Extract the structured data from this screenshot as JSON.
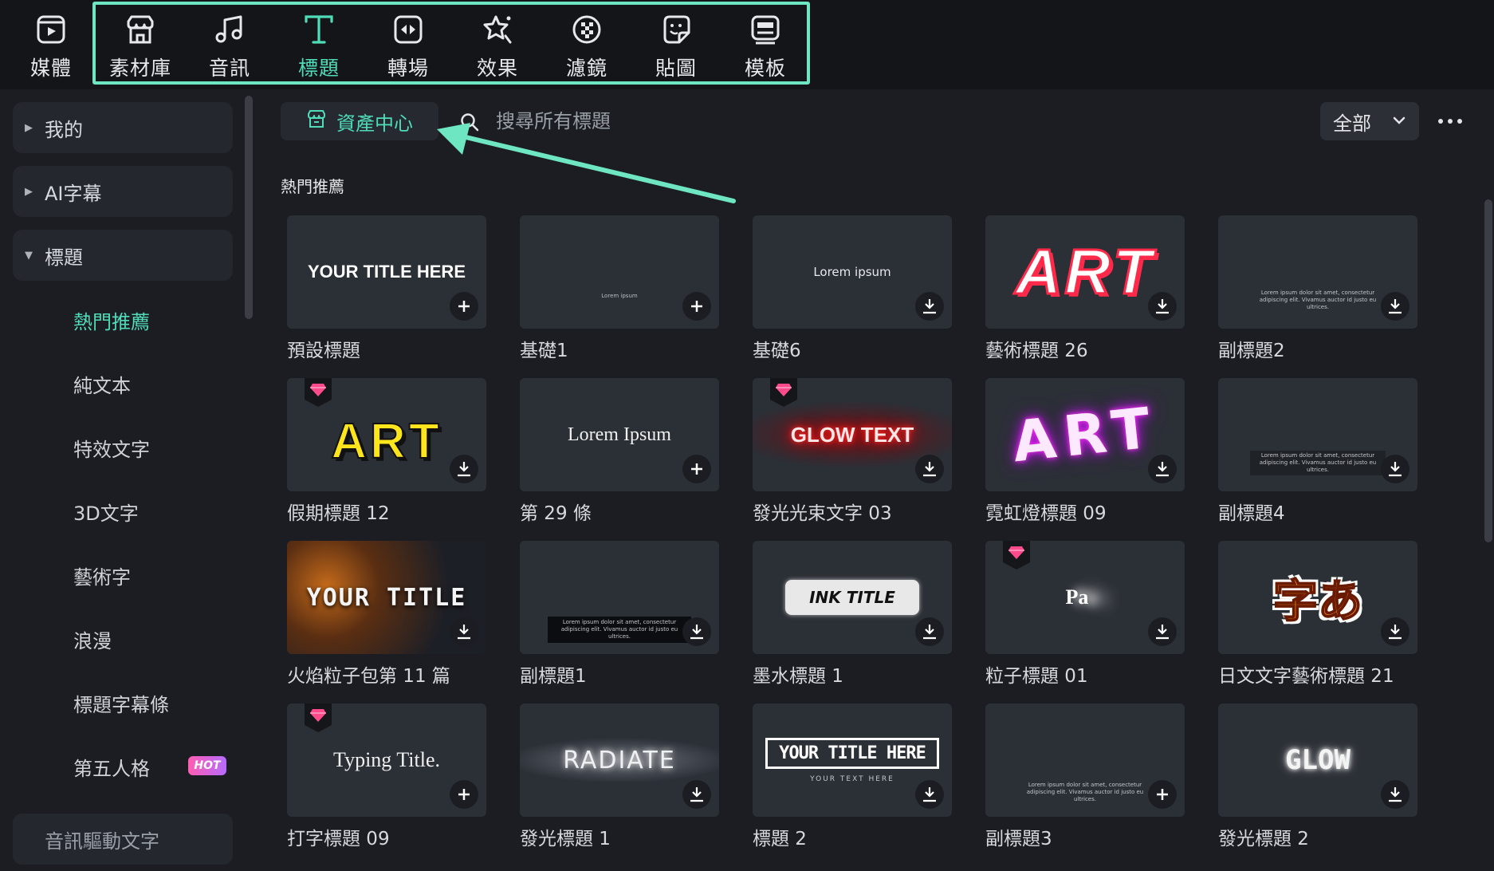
{
  "toolbar": {
    "items": [
      {
        "label": "媒體",
        "icon": "media-icon"
      },
      {
        "label": "素材庫",
        "icon": "stock-library-icon"
      },
      {
        "label": "音訊",
        "icon": "music-note-icon"
      },
      {
        "label": "標題",
        "icon": "title-t-icon"
      },
      {
        "label": "轉場",
        "icon": "transition-icon"
      },
      {
        "label": "效果",
        "icon": "effects-star-icon"
      },
      {
        "label": "濾鏡",
        "icon": "filter-icon"
      },
      {
        "label": "貼圖",
        "icon": "sticker-icon"
      },
      {
        "label": "模板",
        "icon": "template-icon"
      }
    ],
    "active": "標題"
  },
  "sidebar": {
    "groups": [
      {
        "label": "我的",
        "expanded": false
      },
      {
        "label": "AI字幕",
        "expanded": false
      },
      {
        "label": "標題",
        "expanded": true
      },
      {
        "label": "音訊驅動文字",
        "expanded": false
      }
    ],
    "subitems": [
      "熱門推薦",
      "純文本",
      "特效文字",
      "3D文字",
      "藝術字",
      "浪漫",
      "標題字幕條",
      "第五人格"
    ],
    "active_sub": "熱門推薦",
    "hot_badge": "HOT"
  },
  "main": {
    "asset_center_label": "資產中心",
    "search_placeholder": "搜尋所有標題",
    "filter_value": "全部",
    "section_title": "熱門推薦"
  },
  "cards": [
    {
      "name": "預設標題",
      "thumb_text": "YOUR TITLE HERE",
      "action": "add",
      "premium": false
    },
    {
      "name": "基礎1",
      "thumb_text": "Lorem ipsum",
      "action": "add",
      "premium": false
    },
    {
      "name": "基礎6",
      "thumb_text": "Lorem ipsum",
      "action": "download",
      "premium": false
    },
    {
      "name": "藝術標題 26",
      "thumb_text": "ART",
      "action": "download",
      "premium": false
    },
    {
      "name": "副標題2",
      "thumb_text": "Lorem ipsum dolor sit amet, consectetur adipiscing elit. Vivamus auctor id justo eu ultrices.",
      "action": "download",
      "premium": false
    },
    {
      "name": "假期標題 12",
      "thumb_text": "ART",
      "action": "download",
      "premium": true
    },
    {
      "name": "第 29 條",
      "thumb_text": "Lorem Ipsum",
      "action": "add",
      "premium": false
    },
    {
      "name": "發光光束文字 03",
      "thumb_text": "GLOW TEXT",
      "action": "download",
      "premium": true
    },
    {
      "name": "霓虹燈標題 09",
      "thumb_text": "ART",
      "action": "download",
      "premium": false
    },
    {
      "name": "副標題4",
      "thumb_text": "Lorem ipsum dolor sit amet, consectetur adipiscing elit. Vivamus auctor id justo eu ultrices.",
      "action": "download",
      "premium": false
    },
    {
      "name": "火焰粒子包第 11 篇",
      "thumb_text": "YOUR TITLE",
      "action": "download",
      "premium": false
    },
    {
      "name": "副標題1",
      "thumb_text": "Lorem ipsum dolor sit amet, consectetur adipiscing elit. Vivamus auctor id justo eu ultrices.",
      "action": "download",
      "premium": false
    },
    {
      "name": "墨水標題 1",
      "thumb_text": "INK TITLE",
      "action": "download",
      "premium": false
    },
    {
      "name": "粒子標題 01",
      "thumb_text": "Pa",
      "action": "download",
      "premium": true
    },
    {
      "name": "日文文字藝術標題 21",
      "thumb_text": "字あ",
      "action": "download",
      "premium": false
    },
    {
      "name": "打字標題 09",
      "thumb_text": "Typing Title.",
      "action": "add",
      "premium": true
    },
    {
      "name": "發光標題 1",
      "thumb_text": "RADIATE",
      "action": "download",
      "premium": false
    },
    {
      "name": "標題 2",
      "thumb_text": "YOUR TITLE HERE",
      "thumb_sub": "YOUR TEXT HERE",
      "action": "download",
      "premium": false
    },
    {
      "name": "副標題3",
      "thumb_text": "Lorem ipsum dolor sit amet, consectetur adipiscing elit. Vivamus auctor id justo eu ultrices.",
      "action": "add",
      "premium": false
    },
    {
      "name": "發光標題 2",
      "thumb_text": "GLOW",
      "action": "download",
      "premium": false
    }
  ],
  "colors": {
    "accent": "#4fdcb8",
    "highlight_box": "#6ee6c2",
    "background": "#1b1d22",
    "card": "#2b2f36"
  }
}
